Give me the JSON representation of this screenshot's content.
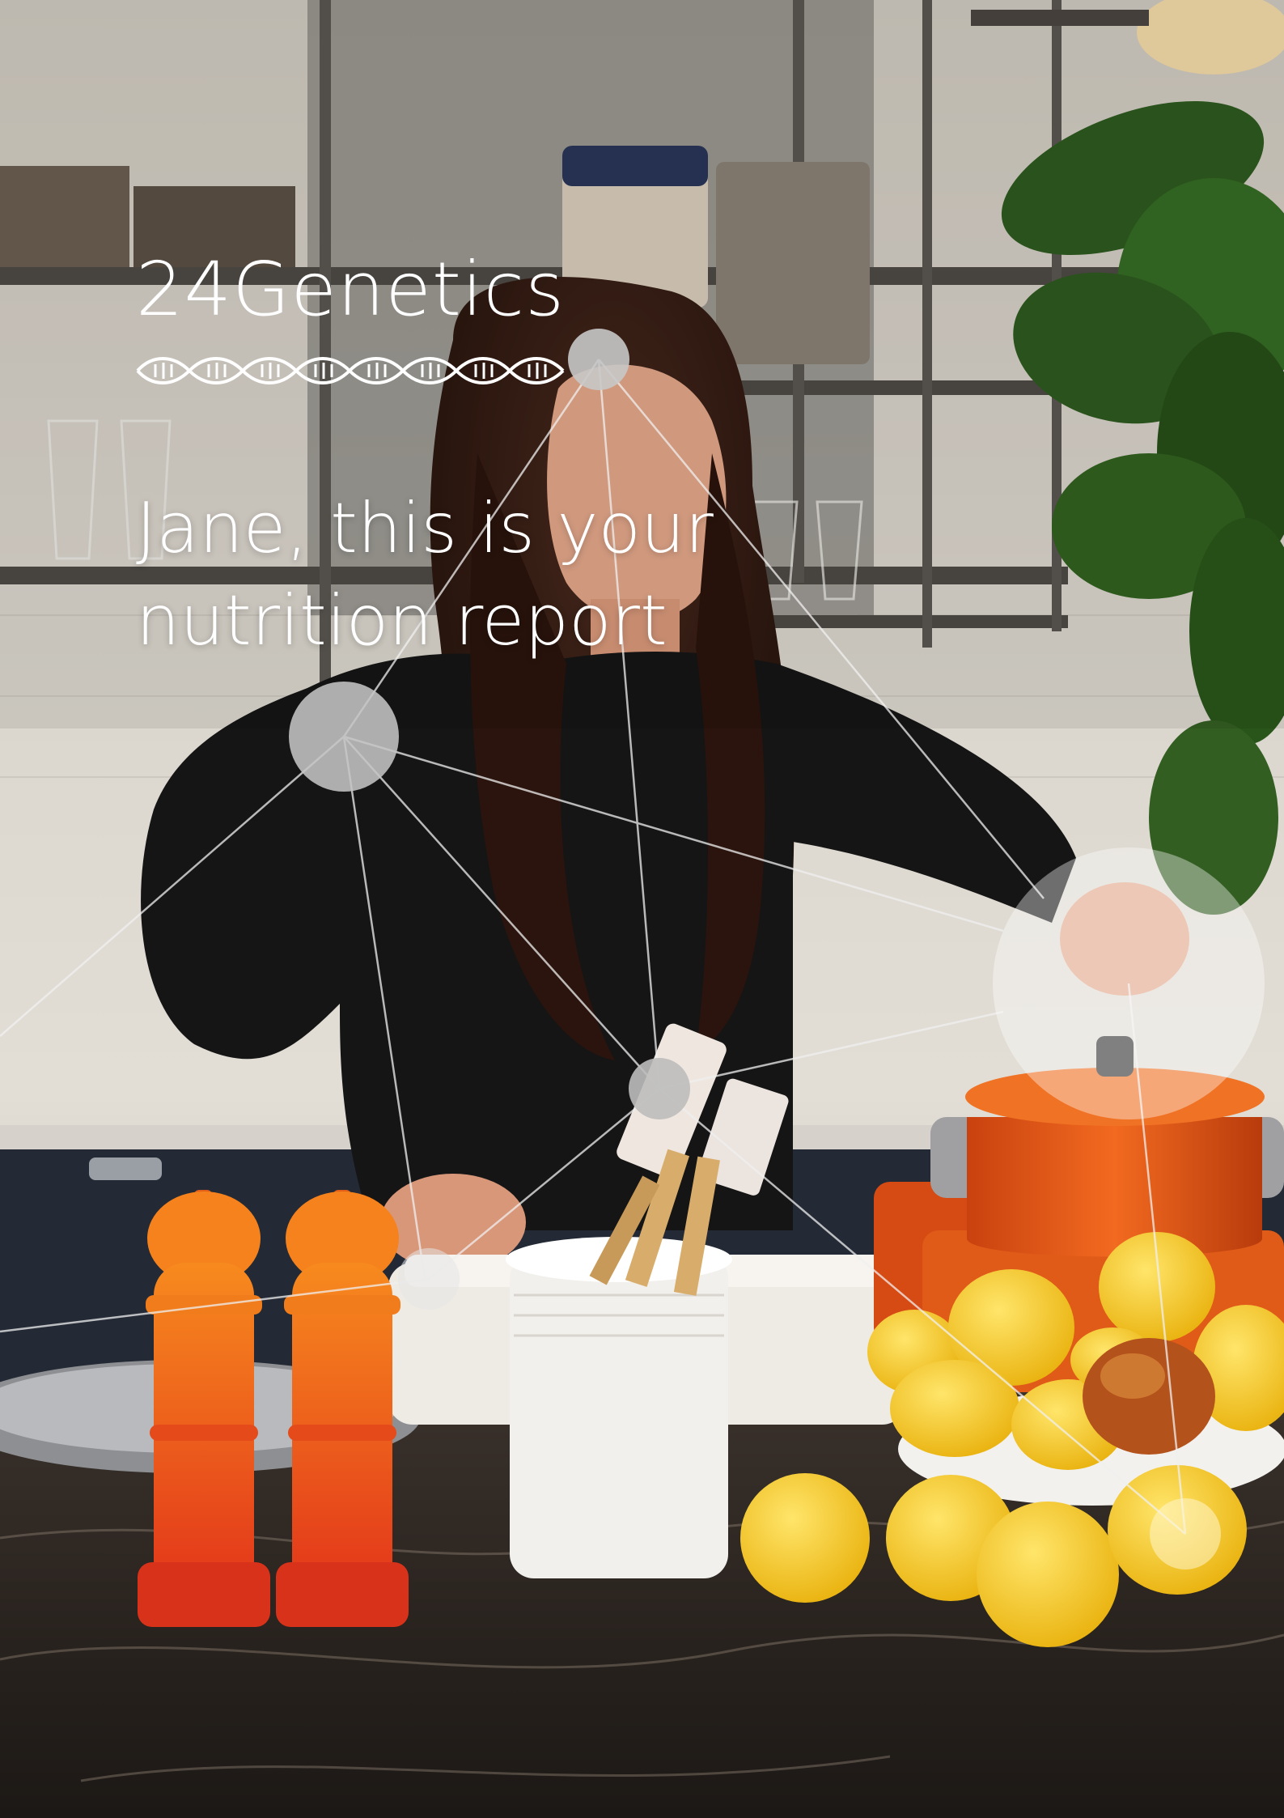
{
  "cover": {
    "brand": "24Genetics",
    "title_line1": "Jane, this is your",
    "title_line2": "nutrition report"
  },
  "photo": {
    "subject": "kitchen-scene-woman-cooking",
    "colors": {
      "wall": "#d9d6cf",
      "shelf": "#5a5550",
      "hair": "#3a1f17",
      "sweater": "#151515",
      "pot": "#e8561a",
      "grinder": "#f0651a",
      "lemon": "#f2c21b",
      "counter": "#2a2420",
      "leaf": "#2e5a1f"
    }
  },
  "overlay": {
    "node_color": "#c8c8c8",
    "line_color": "#e8e8e8"
  }
}
